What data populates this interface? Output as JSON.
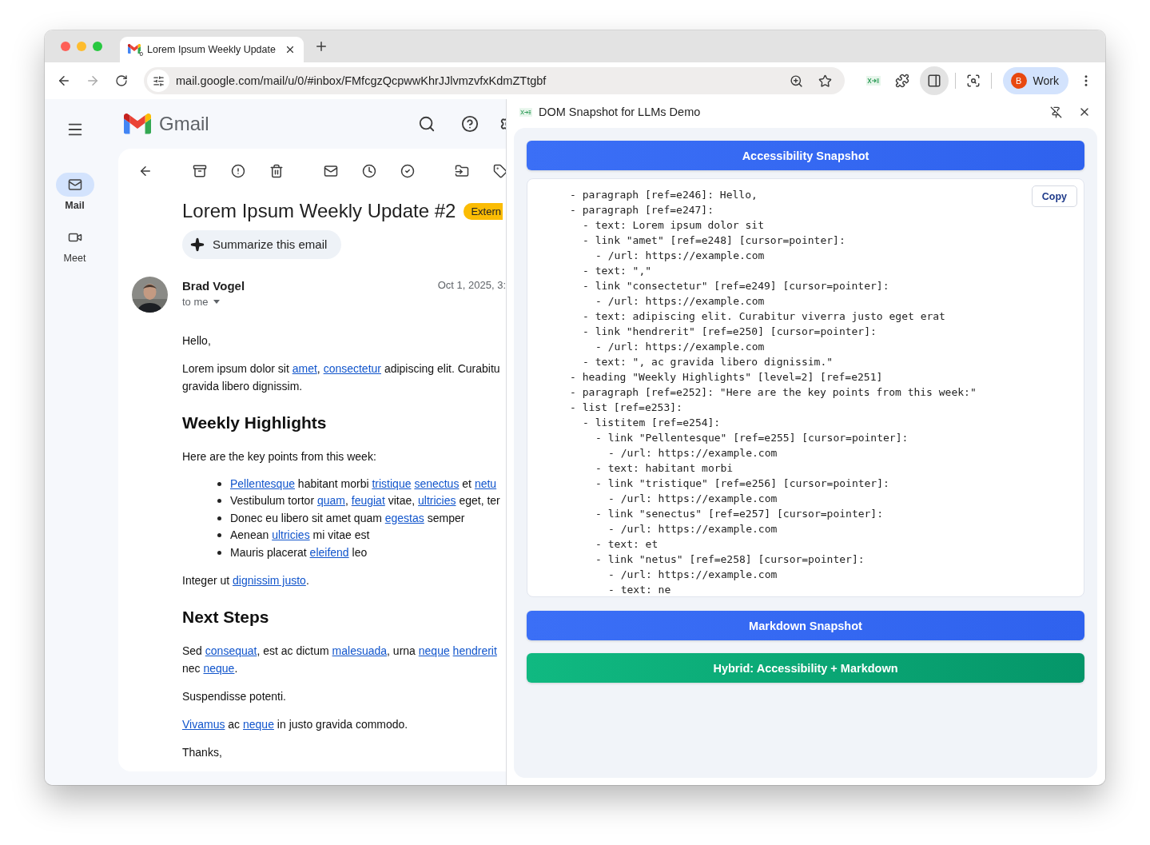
{
  "browser": {
    "tab": {
      "title": "Lorem Ipsum Weekly Update",
      "favicon_count": "0"
    },
    "address_bar": {
      "url": "mail.google.com/mail/u/0/#inbox/FMfcgzQcpwwKhrJJlvmzvfxKdmZTtgbf"
    },
    "profile": {
      "initial": "B",
      "label": "Work"
    }
  },
  "gmail": {
    "logo_text": "Gmail",
    "nav": [
      {
        "kind": "mail",
        "label": "Mail",
        "selected": true
      },
      {
        "kind": "meet",
        "label": "Meet",
        "selected": false
      }
    ],
    "email": {
      "subject": "Lorem Ipsum Weekly Update #2",
      "badge": "Extern",
      "summarize": "Summarize this email",
      "sender": "Brad Vogel",
      "recipient": "to me",
      "date": "Oct 1, 2025, 3:",
      "body": [
        {
          "kind": "paragraph",
          "segments": [
            {
              "kind": "text",
              "text": "Hello,"
            }
          ]
        },
        {
          "kind": "paragraph",
          "segments": [
            {
              "kind": "text",
              "text": "Lorem ipsum dolor sit "
            },
            {
              "kind": "link",
              "text": "amet"
            },
            {
              "kind": "text",
              "text": ", "
            },
            {
              "kind": "link",
              "text": "consectetur"
            },
            {
              "kind": "text",
              "text": " adipiscing elit. Curabitu"
            },
            {
              "kind": "break"
            },
            {
              "kind": "text",
              "text": "gravida libero dignissim."
            }
          ]
        },
        {
          "kind": "heading",
          "text": "Weekly Highlights"
        },
        {
          "kind": "paragraph",
          "segments": [
            {
              "kind": "text",
              "text": "Here are the key points from this week:"
            }
          ]
        },
        {
          "kind": "list",
          "items": [
            {
              "segments": [
                {
                  "kind": "link",
                  "text": "Pellentesque"
                },
                {
                  "kind": "text",
                  "text": " habitant morbi "
                },
                {
                  "kind": "link",
                  "text": "tristique"
                },
                {
                  "kind": "space"
                },
                {
                  "kind": "link",
                  "text": "senectus"
                },
                {
                  "kind": "text",
                  "text": " et "
                },
                {
                  "kind": "link",
                  "text": "netu"
                }
              ]
            },
            {
              "segments": [
                {
                  "kind": "text",
                  "text": "Vestibulum tortor "
                },
                {
                  "kind": "link",
                  "text": "quam"
                },
                {
                  "kind": "text",
                  "text": ", "
                },
                {
                  "kind": "link",
                  "text": "feugiat"
                },
                {
                  "kind": "text",
                  "text": " vitae, "
                },
                {
                  "kind": "link",
                  "text": "ultricies"
                },
                {
                  "kind": "text",
                  "text": " eget, ter"
                }
              ]
            },
            {
              "segments": [
                {
                  "kind": "text",
                  "text": "Donec eu libero sit amet quam "
                },
                {
                  "kind": "link",
                  "text": "egestas"
                },
                {
                  "kind": "text",
                  "text": " semper"
                }
              ]
            },
            {
              "segments": [
                {
                  "kind": "text",
                  "text": "Aenean "
                },
                {
                  "kind": "link",
                  "text": "ultricies"
                },
                {
                  "kind": "text",
                  "text": " mi vitae est"
                }
              ]
            },
            {
              "segments": [
                {
                  "kind": "text",
                  "text": "Mauris placerat "
                },
                {
                  "kind": "link",
                  "text": "eleifend"
                },
                {
                  "kind": "text",
                  "text": " leo"
                }
              ]
            }
          ]
        },
        {
          "kind": "paragraph",
          "segments": [
            {
              "kind": "text",
              "text": "Integer ut "
            },
            {
              "kind": "link",
              "text": "dignissim justo"
            },
            {
              "kind": "text",
              "text": "."
            }
          ]
        },
        {
          "kind": "heading",
          "text": "Next Steps"
        },
        {
          "kind": "paragraph",
          "segments": [
            {
              "kind": "text",
              "text": "Sed "
            },
            {
              "kind": "link",
              "text": "consequat"
            },
            {
              "kind": "text",
              "text": ", est ac dictum "
            },
            {
              "kind": "link",
              "text": "malesuada"
            },
            {
              "kind": "text",
              "text": ", urna "
            },
            {
              "kind": "link",
              "text": "neque"
            },
            {
              "kind": "space"
            },
            {
              "kind": "link",
              "text": "hendrerit"
            },
            {
              "kind": "break"
            },
            {
              "kind": "text",
              "text": "nec "
            },
            {
              "kind": "link",
              "text": "neque"
            },
            {
              "kind": "text",
              "text": "."
            }
          ]
        },
        {
          "kind": "paragraph",
          "segments": [
            {
              "kind": "text",
              "text": "Suspendisse potenti."
            }
          ]
        },
        {
          "kind": "paragraph",
          "segments": [
            {
              "kind": "link",
              "text": "Vivamus"
            },
            {
              "kind": "text",
              "text": " ac "
            },
            {
              "kind": "link",
              "text": "neque"
            },
            {
              "kind": "text",
              "text": " in justo gravida commodo."
            }
          ]
        },
        {
          "kind": "paragraph",
          "segments": [
            {
              "kind": "text",
              "text": "Thanks,"
            }
          ]
        }
      ]
    }
  },
  "side_panel": {
    "title": "DOM Snapshot for LLMs Demo",
    "buttons_top": [
      {
        "kind": "primary",
        "label": "Accessibility Snapshot"
      }
    ],
    "snapshot": {
      "copy": "Copy",
      "tree": [
        {
          "text": "- paragraph [ref=e246]: Hello,"
        },
        {
          "text": "- paragraph [ref=e247]:",
          "children": [
            {
              "text": "- text: Lorem ipsum dolor sit"
            },
            {
              "text": "- link \"amet\" [ref=e248] [cursor=pointer]:",
              "children": [
                {
                  "text": "- /url: https://example.com"
                }
              ]
            },
            {
              "text": "- text: \",\""
            },
            {
              "text": "- link \"consectetur\" [ref=e249] [cursor=pointer]:",
              "children": [
                {
                  "text": "- /url: https://example.com"
                }
              ]
            },
            {
              "text": "- text: adipiscing elit. Curabitur viverra justo eget erat"
            },
            {
              "text": "- link \"hendrerit\" [ref=e250] [cursor=pointer]:",
              "children": [
                {
                  "text": "- /url: https://example.com"
                }
              ]
            },
            {
              "text": "- text: \", ac gravida libero dignissim.\""
            }
          ]
        },
        {
          "text": "- heading \"Weekly Highlights\" [level=2] [ref=e251]"
        },
        {
          "text": "- paragraph [ref=e252]: \"Here are the key points from this week:\""
        },
        {
          "text": "- list [ref=e253]:",
          "children": [
            {
              "text": "- listitem [ref=e254]:",
              "children": [
                {
                  "text": "- link \"Pellentesque\" [ref=e255] [cursor=pointer]:",
                  "children": [
                    {
                      "text": "- /url: https://example.com"
                    }
                  ]
                },
                {
                  "text": "- text: habitant morbi"
                },
                {
                  "text": "- link \"tristique\" [ref=e256] [cursor=pointer]:",
                  "children": [
                    {
                      "text": "- /url: https://example.com"
                    }
                  ]
                },
                {
                  "text": "- link \"senectus\" [ref=e257] [cursor=pointer]:",
                  "children": [
                    {
                      "text": "- /url: https://example.com"
                    }
                  ]
                },
                {
                  "text": "- text: et"
                },
                {
                  "text": "- link \"netus\" [ref=e258] [cursor=pointer]:",
                  "children": [
                    {
                      "text": "- /url: https://example.com"
                    },
                    {
                      "text": "- text: ne"
                    }
                  ]
                }
              ]
            }
          ]
        }
      ]
    },
    "buttons_bottom": [
      {
        "kind": "primary",
        "label": "Markdown Snapshot"
      },
      {
        "kind": "success",
        "label": "Hybrid: Accessibility + Markdown"
      }
    ]
  }
}
